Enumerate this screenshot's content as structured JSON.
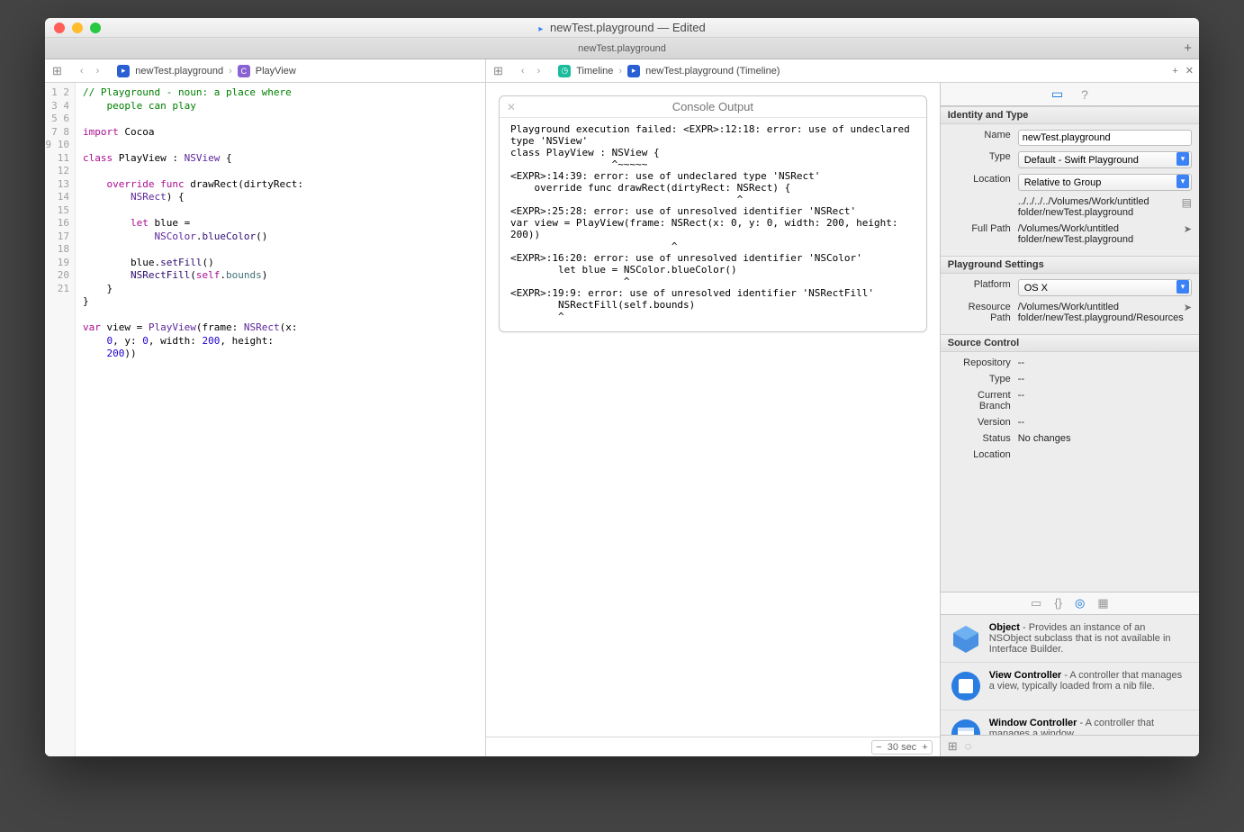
{
  "title": "newTest.playground — Edited",
  "tab_title": "newTest.playground",
  "jumpbar_left": {
    "file": "newTest.playground",
    "symbol": "PlayView"
  },
  "jumpbar_right": {
    "timeline": "Timeline",
    "crumb": "newTest.playground (Timeline)"
  },
  "line_numbers": [
    "1",
    "2",
    "3",
    "4",
    "5",
    "6",
    "7",
    "8",
    "9",
    "10",
    "11",
    "12",
    "13",
    "14",
    "15",
    "16",
    "17",
    "18",
    "19",
    "20",
    "21"
  ],
  "console": {
    "title": "Console Output",
    "text": "Playground execution failed: <EXPR>:12:18: error: use of undeclared type 'NSView'\nclass PlayView : NSView {\n                 ^~~~~~\n<EXPR>:14:39: error: use of undeclared type 'NSRect'\n    override func drawRect(dirtyRect: NSRect) {\n                                      ^\n<EXPR>:25:28: error: use of unresolved identifier 'NSRect'\nvar view = PlayView(frame: NSRect(x: 0, y: 0, width: 200, height: 200))\n                           ^\n<EXPR>:16:20: error: use of unresolved identifier 'NSColor'\n        let blue = NSColor.blueColor()\n                   ^\n<EXPR>:19:9: error: use of unresolved identifier 'NSRectFill'\n        NSRectFill(self.bounds)\n        ^"
  },
  "timeline_seconds": "30",
  "timeline_unit": "sec",
  "identity": {
    "section": "Identity and Type",
    "name_label": "Name",
    "name": "newTest.playground",
    "type_label": "Type",
    "type": "Default - Swift Playground",
    "location_label": "Location",
    "location": "Relative to Group",
    "rel_path": "../../../../Volumes/Work/untitled folder/newTest.playground",
    "fullpath_label": "Full Path",
    "fullpath": "/Volumes/Work/untitled folder/newTest.playground"
  },
  "playground": {
    "section": "Playground Settings",
    "platform_label": "Platform",
    "platform": "OS X",
    "respath_label": "Resource Path",
    "respath": "/Volumes/Work/untitled folder/newTest.playground/Resources"
  },
  "scm": {
    "section": "Source Control",
    "repo_label": "Repository",
    "repo": "--",
    "type_label": "Type",
    "type": "--",
    "branch_label": "Current Branch",
    "branch": "--",
    "version_label": "Version",
    "version": "--",
    "status_label": "Status",
    "status": "No changes",
    "location_label": "Location",
    "location": ""
  },
  "library": [
    {
      "title": "Object",
      "desc": " - Provides an instance of an NSObject subclass that is not available in Interface Builder."
    },
    {
      "title": "View Controller",
      "desc": " - A controller that manages a view, typically loaded from a nib file."
    },
    {
      "title": "Window Controller",
      "desc": " - A controller that manages a window"
    }
  ]
}
